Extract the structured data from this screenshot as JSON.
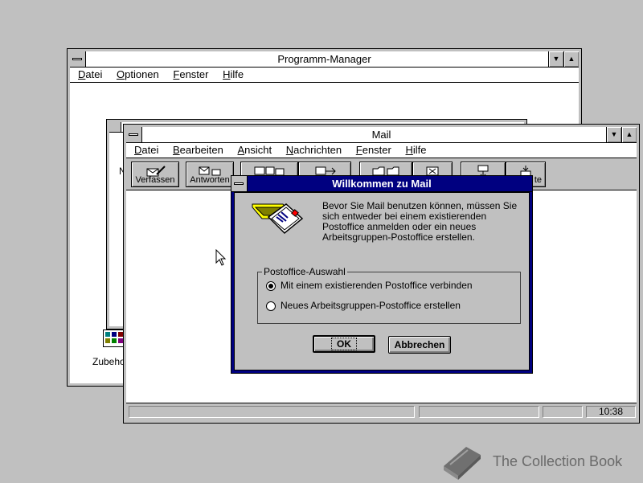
{
  "programm_manager": {
    "title": "Programm-Manager",
    "menu": [
      "Datei",
      "Optionen",
      "Fenster",
      "Hilfe"
    ],
    "group_label_fragment": "N",
    "icon_label": "Zubeho"
  },
  "mail": {
    "title": "Mail",
    "menu": [
      "Datei",
      "Bearbeiten",
      "Ansicht",
      "Nachrichten",
      "Fenster",
      "Hilfe"
    ],
    "toolbar": [
      "Verfassen",
      "Antworten",
      "",
      "",
      "",
      "",
      "",
      "te"
    ],
    "status_time": "10:38"
  },
  "dialog": {
    "title": "Willkommen zu Mail",
    "message": "Bevor Sie Mail benutzen können, müssen Sie sich entweder bei einem existierenden Postoffice anmelden oder ein neues Arbeitsgruppen-Postoffice erstellen.",
    "group_title": "Postoffice-Auswahl",
    "option_1": "Mit einem existierenden Postoffice verbinden",
    "option_2": "Neues Arbeitsgruppen-Postoffice erstellen",
    "ok_label": "OK",
    "cancel_label": "Abbrechen",
    "selected_option": 1
  },
  "watermark": "The Collection Book",
  "colors": {
    "desktop": "#c0c0c0",
    "active_title": "#000080",
    "window_bg": "#ffffff"
  }
}
